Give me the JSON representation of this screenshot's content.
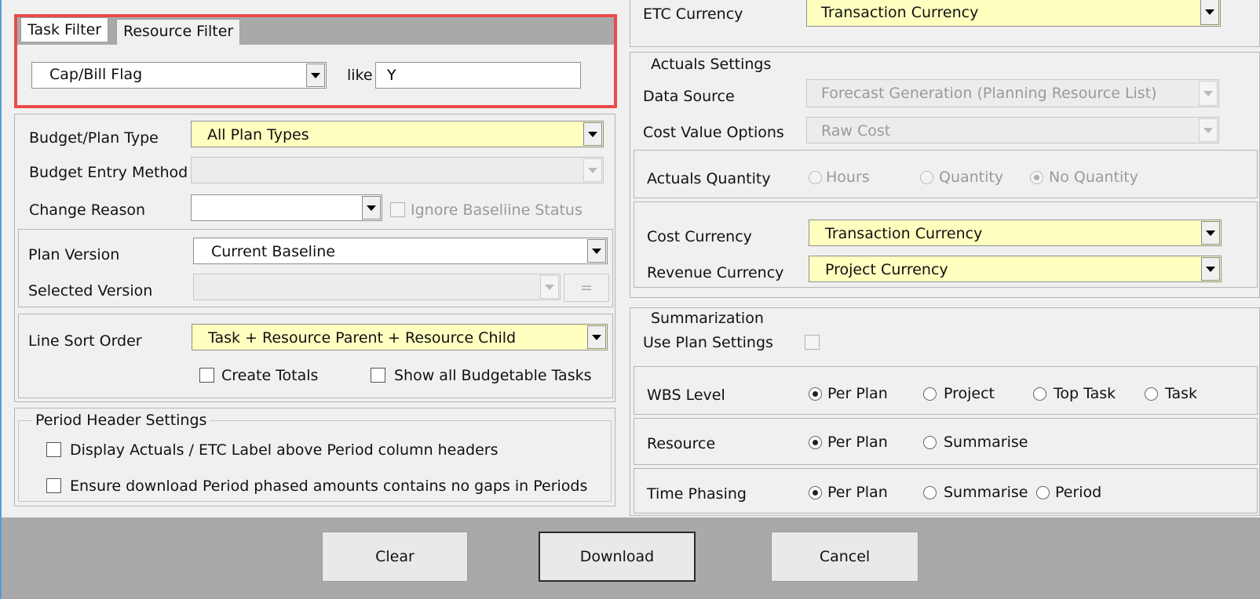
{
  "filter": {
    "tabs": [
      {
        "label": "Task Filter"
      },
      {
        "label": "Resource Filter"
      }
    ],
    "field": "Cap/Bill Flag",
    "operator": "like",
    "value": "Y"
  },
  "plan": {
    "budget_plan_type_label": "Budget/Plan Type",
    "budget_plan_type_value": "All Plan Types",
    "budget_entry_method_label": "Budget Entry Method",
    "budget_entry_method_value": "",
    "change_reason_label": "Change Reason",
    "change_reason_value": "",
    "ignore_baseline_label": "Ignore Baseliine Status",
    "plan_version_label": "Plan Version",
    "plan_version_value": "Current Baseline",
    "selected_version_label": "Selected Version",
    "selected_version_value": "",
    "equals_label": "=",
    "line_sort_label": "Line Sort Order",
    "line_sort_value": "Task + Resource Parent + Resource Child",
    "create_totals_label": "Create Totals",
    "show_budgetable_label": "Show all Budgetable Tasks"
  },
  "period": {
    "title": "Period Header Settings",
    "display_actuals_label": "Display Actuals / ETC Label above Period column headers",
    "ensure_no_gaps_label": "Ensure download Period phased amounts contains no gaps in Periods"
  },
  "etc": {
    "label": "ETC Currency",
    "value": "Transaction Currency"
  },
  "actuals": {
    "title": "Actuals Settings",
    "data_source_label": "Data Source",
    "data_source_value": "Forecast Generation (Planning Resource List)",
    "cost_value_label": "Cost Value Options",
    "cost_value_value": "Raw Cost",
    "quantity_label": "Actuals Quantity",
    "quantity_options": [
      "Hours",
      "Quantity",
      "No Quantity"
    ],
    "quantity_selected": "No Quantity",
    "cost_currency_label": "Cost Currency",
    "cost_currency_value": "Transaction Currency",
    "revenue_currency_label": "Revenue Currency",
    "revenue_currency_value": "Project Currency"
  },
  "summarization": {
    "title": "Summarization",
    "use_plan_label": "Use Plan Settings",
    "wbs_label": "WBS Level",
    "wbs_options": [
      "Per Plan",
      "Project",
      "Top Task",
      "Task"
    ],
    "wbs_selected": "Per Plan",
    "resource_label": "Resource",
    "resource_options": [
      "Per Plan",
      "Summarise"
    ],
    "resource_selected": "Per Plan",
    "time_label": "Time Phasing",
    "time_options": [
      "Per Plan",
      "Summarise",
      "Period"
    ],
    "time_selected": "Per Plan"
  },
  "buttons": {
    "clear": "Clear",
    "download": "Download",
    "cancel": "Cancel"
  },
  "colors": {
    "highlight_border": "#e84c4c",
    "required_field_bg": "#ffffc0",
    "window_bg": "#f0f0f0"
  }
}
